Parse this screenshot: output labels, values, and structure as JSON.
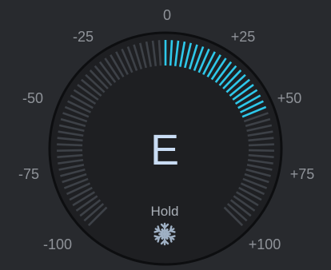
{
  "tuner": {
    "note": "E",
    "deviation_cents": 50,
    "scale_labels": [
      {
        "name": "zero",
        "text": "0"
      },
      {
        "name": "minus-25",
        "text": "-25"
      },
      {
        "name": "plus-25",
        "text": "+25"
      },
      {
        "name": "minus-50",
        "text": "-50"
      },
      {
        "name": "plus-50",
        "text": "+50"
      },
      {
        "name": "minus-75",
        "text": "-75"
      },
      {
        "name": "plus-75",
        "text": "+75"
      },
      {
        "name": "minus-100",
        "text": "-100"
      },
      {
        "name": "plus-100",
        "text": "+100"
      }
    ],
    "hold": {
      "label": "Hold",
      "icon": "snowflake-icon"
    }
  },
  "colors": {
    "background": "#282a2e",
    "dial": "#1e1f22",
    "active_tick": "#2ec8ea",
    "inactive_tick": "#3d4147",
    "note": "#c9dcf4",
    "label": "#8f9399",
    "snowflake": "#9fb0c4"
  }
}
